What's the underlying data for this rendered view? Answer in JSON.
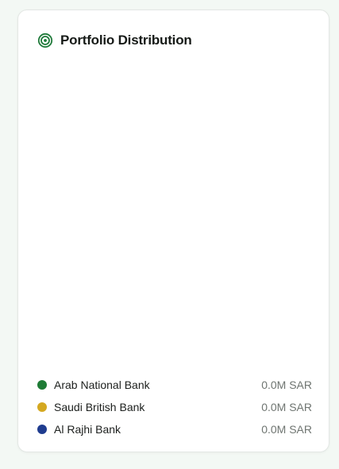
{
  "card": {
    "title": "Portfolio Distribution",
    "title_icon": "target-icon",
    "icon_color": "#1f7a3a"
  },
  "legend": [
    {
      "name": "Arab National Bank",
      "value": "0.0M SAR",
      "color": "#1e7b35"
    },
    {
      "name": "Saudi British Bank",
      "value": "0.0M SAR",
      "color": "#d4a820"
    },
    {
      "name": "Al Rajhi Bank",
      "value": "0.0M SAR",
      "color": "#1f3c8f"
    }
  ]
}
